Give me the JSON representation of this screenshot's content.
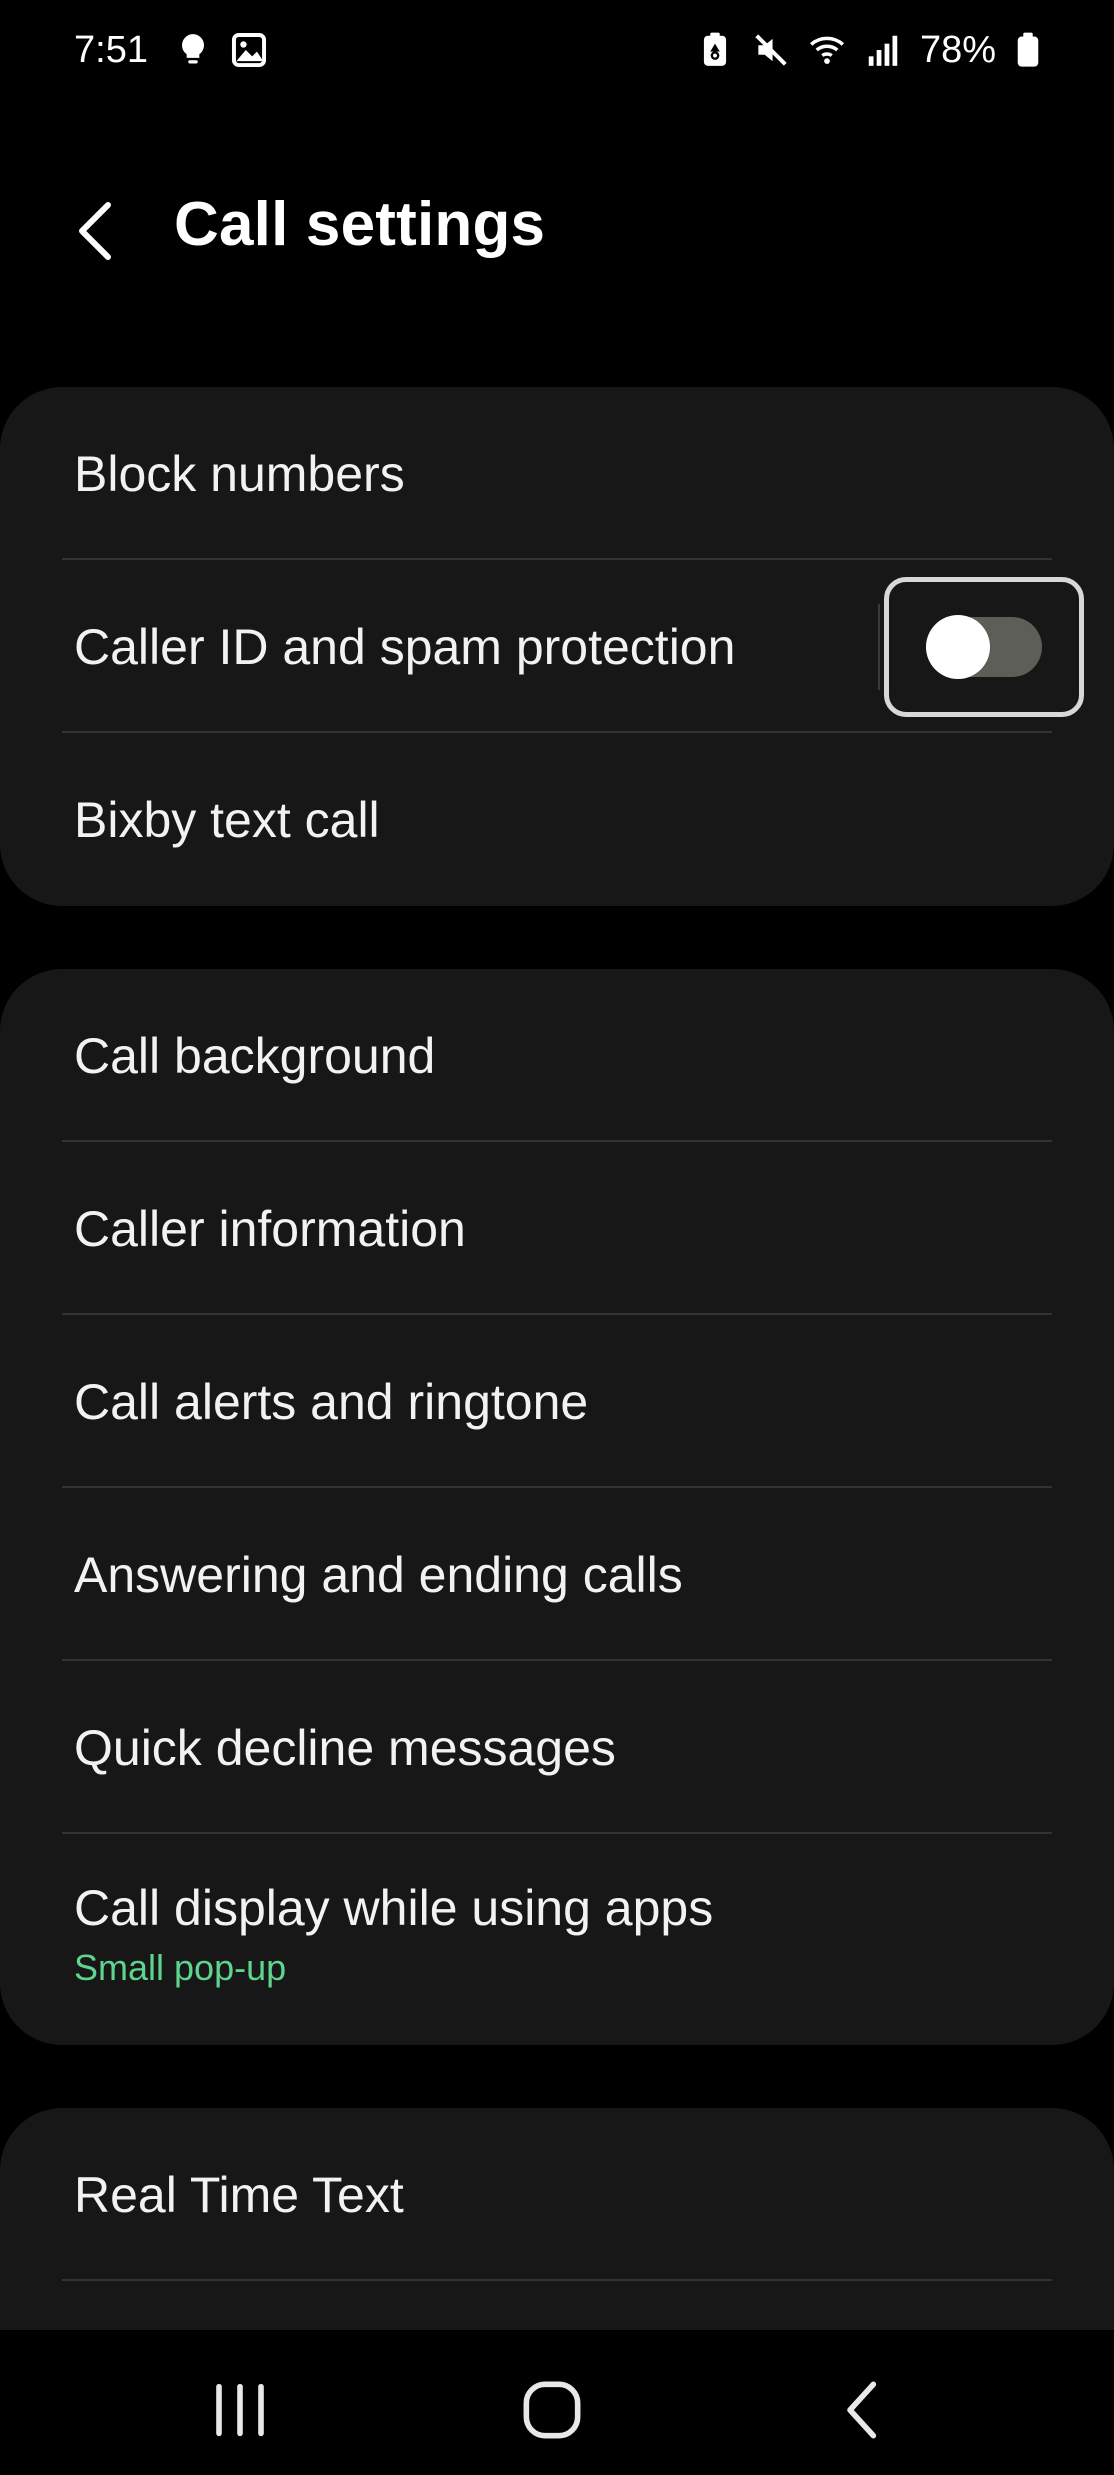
{
  "status_bar": {
    "time": "7:51",
    "battery_percent": "78%",
    "left_icons": [
      "bulb-icon",
      "gallery-icon"
    ],
    "right_icons": [
      "battery-saver-icon",
      "mute-icon",
      "wifi-icon",
      "signal-icon",
      "battery-icon"
    ]
  },
  "header": {
    "back_icon": "chevron-left-icon",
    "title": "Call settings"
  },
  "groups": [
    {
      "items": [
        {
          "label": "Block numbers"
        },
        {
          "label": "Caller ID and spam protection",
          "toggle": {
            "on": false
          }
        },
        {
          "label": "Bixby text call"
        }
      ]
    },
    {
      "items": [
        {
          "label": "Call background"
        },
        {
          "label": "Caller information"
        },
        {
          "label": "Call alerts and ringtone"
        },
        {
          "label": "Answering and ending calls"
        },
        {
          "label": "Quick decline messages"
        },
        {
          "label": "Call display while using apps",
          "sublabel": "Small pop-up"
        }
      ]
    },
    {
      "items": [
        {
          "label": "Real Time Text"
        }
      ]
    }
  ],
  "nav_bar": {
    "icons": [
      "recent-apps-icon",
      "home-icon",
      "back-icon"
    ]
  },
  "colors": {
    "background": "#000000",
    "card": "#171717",
    "accent_green": "#5fd48f",
    "toggle_track_off": "#5e5e58"
  }
}
